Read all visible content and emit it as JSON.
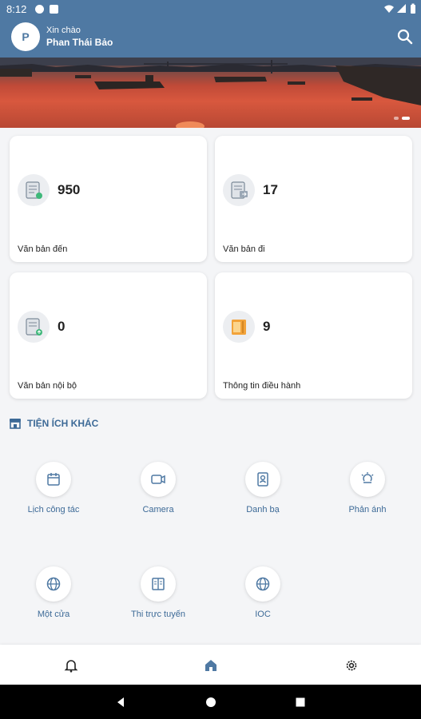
{
  "status_bar": {
    "time": "8:12"
  },
  "header": {
    "avatar_initial": "P",
    "greeting": "Xin chào",
    "user_name": "Phan Thái Bảo",
    "search_icon": "search-icon"
  },
  "banner": {
    "alt": "city-river-sunset"
  },
  "stats": [
    {
      "icon": "incoming-document-icon",
      "value": "950",
      "label": "Văn bản đến"
    },
    {
      "icon": "outgoing-document-icon",
      "value": "17",
      "label": "Văn bản đi"
    },
    {
      "icon": "internal-document-icon",
      "value": "0",
      "label": "Văn bản nội bộ"
    },
    {
      "icon": "briefing-folder-icon",
      "value": "9",
      "label": "Thông tin điều hành"
    }
  ],
  "section": {
    "title": "TIỆN ÍCH KHÁC",
    "icon": "store-icon"
  },
  "utilities": [
    {
      "icon": "calendar-icon",
      "label": "Lịch công tác"
    },
    {
      "icon": "video-camera-icon",
      "label": "Camera"
    },
    {
      "icon": "contact-book-icon",
      "label": "Danh bạ"
    },
    {
      "icon": "feedback-bulb-icon",
      "label": "Phản ánh"
    },
    {
      "icon": "globe-icon",
      "label": "Một cửa"
    },
    {
      "icon": "exam-book-icon",
      "label": "Thi trực tuyến"
    },
    {
      "icon": "globe-icon",
      "label": "IOC"
    }
  ],
  "bottom_nav": [
    {
      "icon": "bell-icon"
    },
    {
      "icon": "home-icon",
      "active": true
    },
    {
      "icon": "gear-icon"
    }
  ],
  "colors": {
    "primary": "#4f79a3",
    "accent_text": "#3d6a97"
  }
}
